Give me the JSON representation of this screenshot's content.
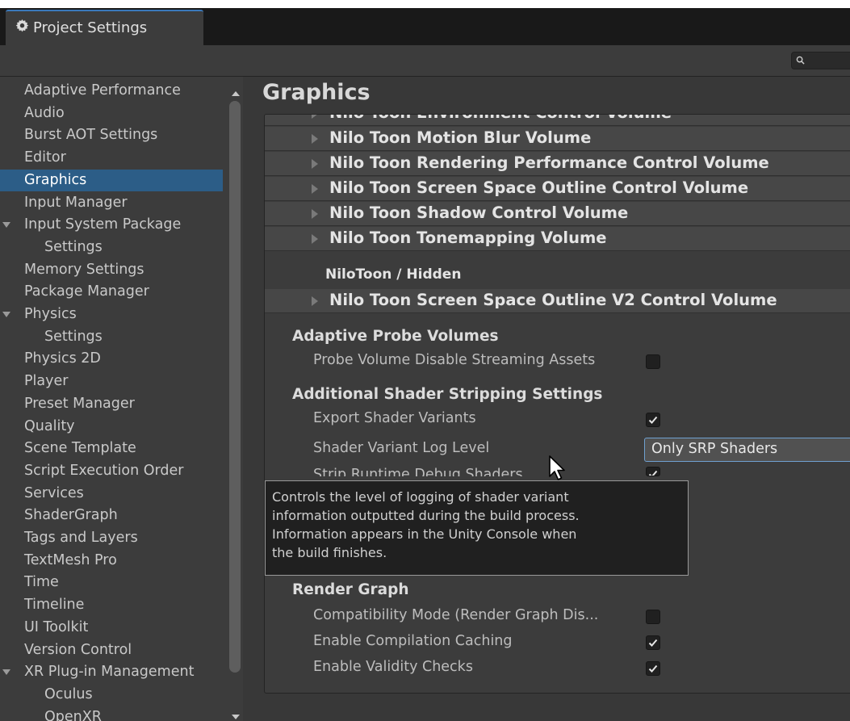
{
  "window": {
    "tab_title": "Project Settings",
    "tab_icon": "gear-icon",
    "search_placeholder": ""
  },
  "sidebar": {
    "items": [
      {
        "label": "Adaptive Performance"
      },
      {
        "label": "Audio"
      },
      {
        "label": "Burst AOT Settings"
      },
      {
        "label": "Editor"
      },
      {
        "label": "Graphics",
        "selected": true
      },
      {
        "label": "Input Manager"
      },
      {
        "label": "Input System Package",
        "expanded": true
      },
      {
        "label": "Settings",
        "child": true
      },
      {
        "label": "Memory Settings"
      },
      {
        "label": "Package Manager"
      },
      {
        "label": "Physics",
        "expanded": true
      },
      {
        "label": "Settings",
        "child": true
      },
      {
        "label": "Physics 2D"
      },
      {
        "label": "Player"
      },
      {
        "label": "Preset Manager"
      },
      {
        "label": "Quality"
      },
      {
        "label": "Scene Template"
      },
      {
        "label": "Script Execution Order"
      },
      {
        "label": "Services"
      },
      {
        "label": "ShaderGraph"
      },
      {
        "label": "Tags and Layers"
      },
      {
        "label": "TextMesh Pro"
      },
      {
        "label": "Time"
      },
      {
        "label": "Timeline"
      },
      {
        "label": "UI Toolkit"
      },
      {
        "label": "Version Control"
      },
      {
        "label": "XR Plug-in Management",
        "expanded": true
      },
      {
        "label": "Oculus",
        "child": true
      },
      {
        "label": "OpenXR",
        "child": true
      }
    ]
  },
  "main": {
    "title": "Graphics",
    "volumes": [
      "Nilo Toon Environment Control Volume",
      "Nilo Toon Motion Blur Volume",
      "Nilo Toon Rendering Performance Control Volume",
      "Nilo Toon Screen Space Outline Control Volume",
      "Nilo Toon Shadow Control Volume",
      "Nilo Toon Tonemapping Volume"
    ],
    "hidden_header": "NiloToon / Hidden",
    "hidden_volumes": [
      "Nilo Toon Screen Space Outline V2 Control Volume"
    ],
    "sections": {
      "apv": {
        "title": "Adaptive Probe Volumes",
        "probe_streaming": {
          "label": "Probe Volume Disable Streaming Assets",
          "checked": false
        }
      },
      "stripping": {
        "title": "Additional Shader Stripping Settings",
        "export_variants": {
          "label": "Export Shader Variants",
          "checked": true
        },
        "log_level": {
          "label": "Shader Variant Log Level",
          "value": "Only SRP Shaders"
        },
        "strip_debug": {
          "label": "Strip Runtime Debug Shaders",
          "checked": true
        }
      },
      "render_graph": {
        "title": "Render Graph",
        "compat_mode": {
          "label": "Compatibility Mode (Render Graph Dis...",
          "checked": false
        },
        "compilation_caching": {
          "label": "Enable Compilation Caching",
          "checked": true
        },
        "validity_checks": {
          "label": "Enable Validity Checks",
          "checked": true
        }
      }
    },
    "tooltip": {
      "lines": [
        "Controls the level of logging of shader variant",
        "information outputted during the build process.",
        "Information appears in the Unity Console when",
        "the build finishes."
      ]
    }
  },
  "colors": {
    "selection": "#2c5d87",
    "panel": "#3c3c3c",
    "row": "#474747",
    "tab_accent": "#3a79bb"
  }
}
